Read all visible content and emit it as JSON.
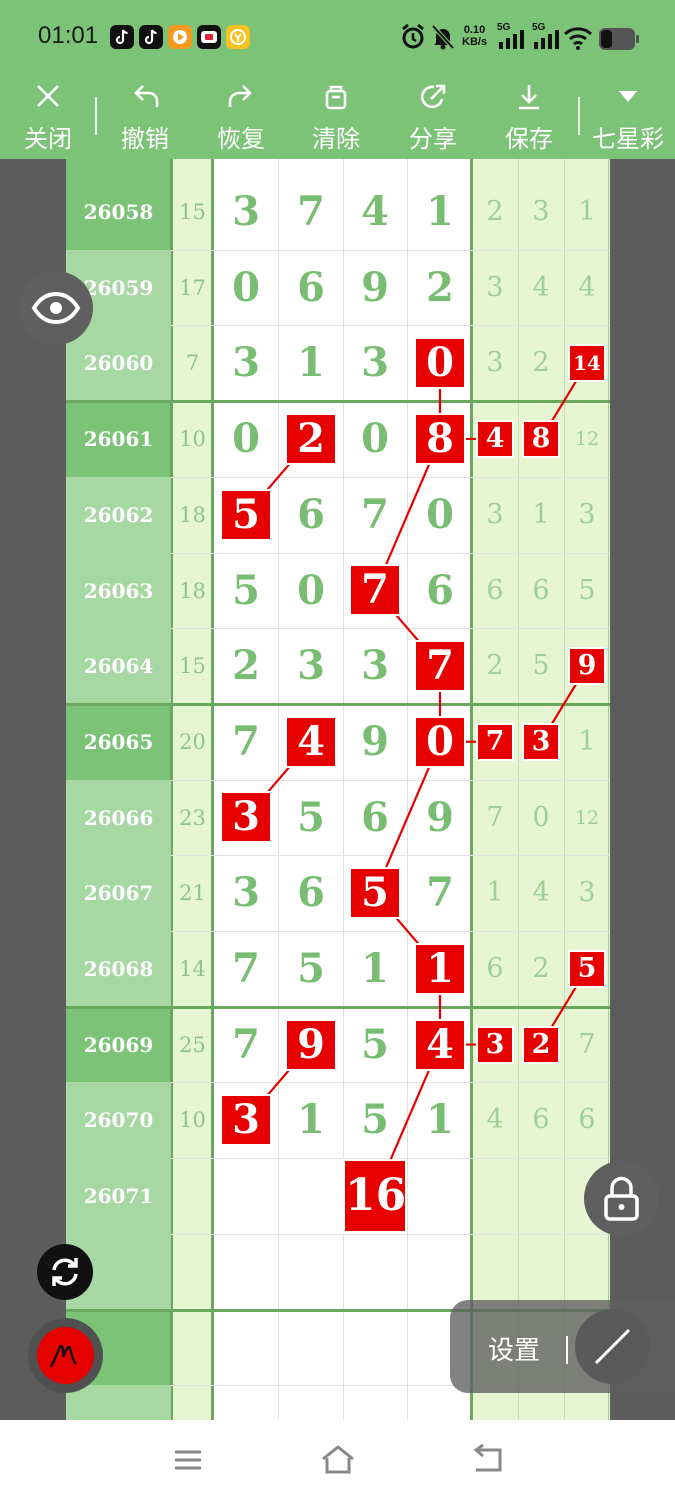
{
  "status_bar": {
    "time": "01:01",
    "net_speed_value": "0.10",
    "net_speed_unit": "KB/s",
    "signal_1": "5G",
    "signal_2": "5G",
    "icons": [
      "tiktok-icon",
      "tiktok-icon",
      "video-app-icon",
      "tiktok-lite-icon",
      "coin-app-icon",
      "alarm-icon",
      "mute-icon",
      "signal-icon",
      "signal-icon",
      "wifi-icon",
      "battery-icon"
    ]
  },
  "toolbar": {
    "close": "关闭",
    "undo": "撤销",
    "redo": "恢复",
    "clear": "清除",
    "share": "分享",
    "save": "保存",
    "lottery": "七星彩"
  },
  "chart": {
    "rows": [
      {
        "issue": "26058",
        "sum": "15",
        "digits": [
          "3",
          "7",
          "4",
          "1"
        ],
        "tails": [
          "2",
          "3",
          "1"
        ]
      },
      {
        "issue": "26059",
        "sum": "17",
        "digits": [
          "0",
          "6",
          "9",
          "2"
        ],
        "tails": [
          "3",
          "4",
          "4"
        ]
      },
      {
        "issue": "26060",
        "sum": "7",
        "digits": [
          "3",
          "1",
          "3",
          "0"
        ],
        "tails": [
          "3",
          "2",
          "14"
        ]
      },
      {
        "issue": "26061",
        "sum": "10",
        "digits": [
          "0",
          "2",
          "0",
          "8"
        ],
        "tails": [
          "4",
          "8",
          "12"
        ]
      },
      {
        "issue": "26062",
        "sum": "18",
        "digits": [
          "5",
          "6",
          "7",
          "0"
        ],
        "tails": [
          "3",
          "1",
          "3"
        ]
      },
      {
        "issue": "26063",
        "sum": "18",
        "digits": [
          "5",
          "0",
          "7",
          "6"
        ],
        "tails": [
          "6",
          "6",
          "5"
        ]
      },
      {
        "issue": "26064",
        "sum": "15",
        "digits": [
          "2",
          "3",
          "3",
          "7"
        ],
        "tails": [
          "2",
          "5",
          "9"
        ]
      },
      {
        "issue": "26065",
        "sum": "20",
        "digits": [
          "7",
          "4",
          "9",
          "0"
        ],
        "tails": [
          "7",
          "3",
          "1"
        ]
      },
      {
        "issue": "26066",
        "sum": "23",
        "digits": [
          "3",
          "5",
          "6",
          "9"
        ],
        "tails": [
          "7",
          "0",
          "12"
        ]
      },
      {
        "issue": "26067",
        "sum": "21",
        "digits": [
          "3",
          "6",
          "5",
          "7"
        ],
        "tails": [
          "1",
          "4",
          "3"
        ]
      },
      {
        "issue": "26068",
        "sum": "14",
        "digits": [
          "7",
          "5",
          "1",
          "1"
        ],
        "tails": [
          "6",
          "2",
          "5"
        ]
      },
      {
        "issue": "26069",
        "sum": "25",
        "digits": [
          "7",
          "9",
          "5",
          "4"
        ],
        "tails": [
          "3",
          "2",
          "7"
        ]
      },
      {
        "issue": "26070",
        "sum": "10",
        "digits": [
          "3",
          "1",
          "5",
          "1"
        ],
        "tails": [
          "4",
          "6",
          "6"
        ]
      },
      {
        "issue": "26071",
        "sum": "",
        "digits": [
          "",
          "",
          "",
          ""
        ],
        "tails": [
          "",
          "",
          ""
        ]
      },
      {
        "issue": "",
        "sum": "",
        "digits": [
          "",
          "",
          "",
          ""
        ],
        "tails": [
          "",
          "",
          ""
        ]
      },
      {
        "issue": "",
        "sum": "",
        "digits": [
          "",
          "",
          "",
          ""
        ],
        "tails": [
          "",
          "",
          ""
        ]
      }
    ],
    "marks": [
      {
        "row": 2,
        "col": "d3",
        "text": "0"
      },
      {
        "row": 2,
        "col": "t2",
        "text": "14"
      },
      {
        "row": 3,
        "col": "d1",
        "text": "2"
      },
      {
        "row": 3,
        "col": "d3",
        "text": "8"
      },
      {
        "row": 3,
        "col": "t0",
        "text": "4"
      },
      {
        "row": 3,
        "col": "t1",
        "text": "8"
      },
      {
        "row": 4,
        "col": "d0",
        "text": "5"
      },
      {
        "row": 5,
        "col": "d2",
        "text": "7"
      },
      {
        "row": 6,
        "col": "d3",
        "text": "7"
      },
      {
        "row": 6,
        "col": "t2",
        "text": "9"
      },
      {
        "row": 7,
        "col": "d1",
        "text": "4"
      },
      {
        "row": 7,
        "col": "d3",
        "text": "0"
      },
      {
        "row": 7,
        "col": "t0",
        "text": "7"
      },
      {
        "row": 7,
        "col": "t1",
        "text": "3"
      },
      {
        "row": 8,
        "col": "d0",
        "text": "3"
      },
      {
        "row": 9,
        "col": "d2",
        "text": "5"
      },
      {
        "row": 10,
        "col": "d3",
        "text": "1"
      },
      {
        "row": 10,
        "col": "t2",
        "text": "5"
      },
      {
        "row": 11,
        "col": "d1",
        "text": "9"
      },
      {
        "row": 11,
        "col": "d3",
        "text": "4"
      },
      {
        "row": 11,
        "col": "t0",
        "text": "3"
      },
      {
        "row": 11,
        "col": "t1",
        "text": "2"
      },
      {
        "row": 12,
        "col": "d0",
        "text": "3"
      },
      {
        "row": 13,
        "col": "d2",
        "text": "16"
      }
    ],
    "colors": {
      "accent_green": "#7cc378",
      "mark_red": "#e60000",
      "pale_green": "#e7f6d2"
    }
  },
  "floating": {
    "settings_label": "设置",
    "icons": [
      "eye-icon",
      "sync-icon",
      "pen-icon",
      "lock-icon",
      "line-tool-icon"
    ]
  },
  "navbar": {
    "icons": [
      "menu-icon",
      "home-icon",
      "back-icon"
    ]
  }
}
